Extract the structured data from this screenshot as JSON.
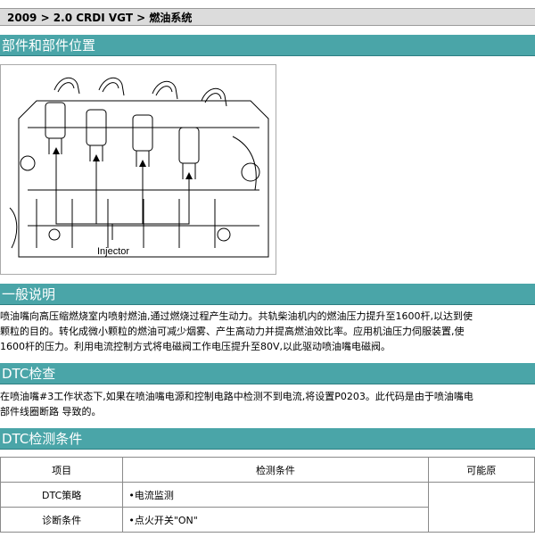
{
  "breadcrumb": "2009 > 2.0 CRDI VGT > 燃油系统",
  "sections": {
    "components": "部件和部件位置",
    "general": "一般说明",
    "dtc_check": "DTC检查",
    "dtc_conditions": "DTC检测条件"
  },
  "diagram": {
    "label": "Injector"
  },
  "general_lines": [
    "喷油嘴向高压缩燃烧室内喷射燃油,通过燃烧过程产生动力。共轨柴油机内的燃油压力提升至1600杆,以达到使",
    "颗粒的目的。转化成微小颗粒的燃油可减少烟雾、产生高动力并提高燃油效比率。应用机油压力伺服装置,使",
    "1600杆的压力。利用电流控制方式将电磁阀工作电压提升至80V,以此驱动喷油嘴电磁阀。"
  ],
  "dtc_check_lines": [
    "在喷油嘴#3工作状态下,如果在喷油嘴电源和控制电路中检测不到电流,将设置P0203。此代码是由于喷油嘴电",
    "部件线圈断路 导致的。"
  ],
  "table": {
    "headers": [
      "项目",
      "检测条件",
      "可能原"
    ],
    "rows": [
      {
        "item": "DTC策略",
        "condition": "•电流监测"
      },
      {
        "item": "诊断条件",
        "condition": "•点火开关\"ON\""
      }
    ]
  }
}
